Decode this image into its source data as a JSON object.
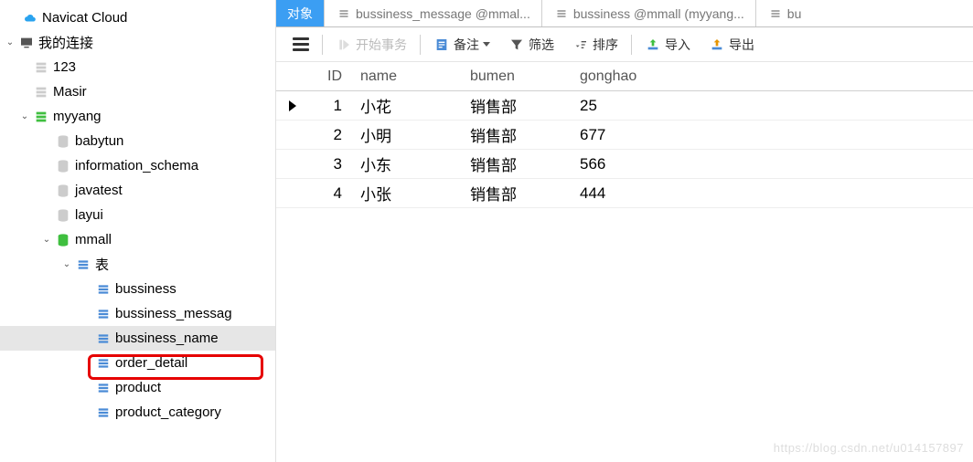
{
  "sidebar": {
    "navicat_cloud": "Navicat Cloud",
    "my_connections": "我的连接",
    "conns": [
      {
        "label": "123"
      },
      {
        "label": "Masir"
      },
      {
        "label": "myyang"
      }
    ],
    "dbs": [
      {
        "label": "babytun"
      },
      {
        "label": "information_schema"
      },
      {
        "label": "javatest"
      },
      {
        "label": "layui"
      },
      {
        "label": "mmall"
      }
    ],
    "tables_folder": "表",
    "tables": [
      {
        "label": "bussiness"
      },
      {
        "label": "bussiness_messag"
      },
      {
        "label": "bussiness_name"
      },
      {
        "label": "order_detail"
      },
      {
        "label": "product"
      },
      {
        "label": "product_category"
      }
    ]
  },
  "tabs": {
    "object": "对象",
    "tab1": "bussiness_message @mmal...",
    "tab2": "bussiness @mmall (myyang...",
    "tab3": "bu"
  },
  "toolbar": {
    "begin_txn": "开始事务",
    "memo": "备注",
    "filter": "筛选",
    "sort": "排序",
    "import": "导入",
    "export": "导出"
  },
  "columns": {
    "id": "ID",
    "name": "name",
    "bumen": "bumen",
    "gonghao": "gonghao"
  },
  "rows": [
    {
      "id": "1",
      "name": "小花",
      "bumen": "销售部",
      "gonghao": "25"
    },
    {
      "id": "2",
      "name": "小明",
      "bumen": "销售部",
      "gonghao": "677"
    },
    {
      "id": "3",
      "name": "小东",
      "bumen": "销售部",
      "gonghao": "566"
    },
    {
      "id": "4",
      "name": "小张",
      "bumen": "销售部",
      "gonghao": "444"
    }
  ],
  "watermark": "https://blog.csdn.net/u014157897"
}
